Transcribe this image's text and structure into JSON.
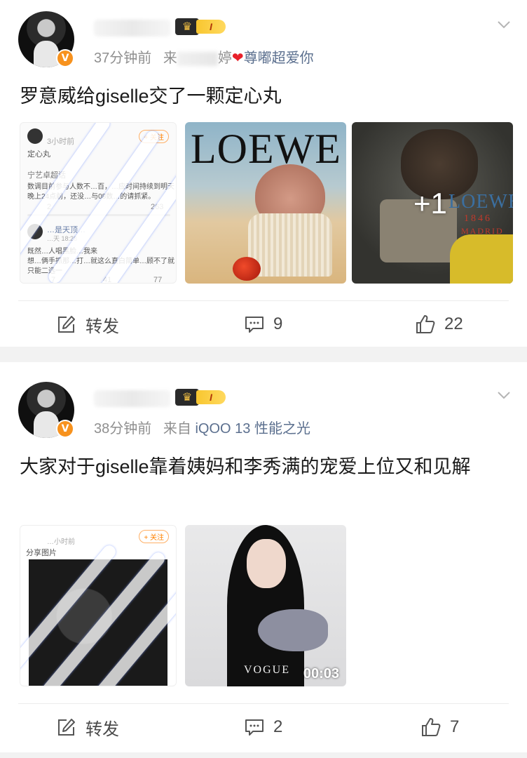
{
  "colors": {
    "accent": "#ff8200",
    "verified": "#f7921e",
    "meta_text": "#8f8f8f",
    "device_text": "#5b6f8e",
    "heart": "#e8202a"
  },
  "posts": [
    {
      "badge_level": "I",
      "time": "37分钟前",
      "source_prefix": "来",
      "source_suffix": "婷",
      "heart": "❤",
      "source_tail": "尊嘟超爱你",
      "text": "罗意威给giselle交了一颗定心丸",
      "images": [
        {
          "type": "screenshot",
          "follow": "+ 关注",
          "time_small": "3小时前",
          "title": "定心丸",
          "tag": "宁艺卓超话",
          "body": [
            "数调目前参与人数不…百，…应时间持续到明天",
            "晚上24点前，还没…与08数…的请抓紧。"
          ],
          "stats": [
            "2",
            "263"
          ],
          "reply_name": "…是天顶…",
          "reply_time": "…天 18:28",
          "reply_body": [
            "既然…人唱黑脸…我来",
            "想…俩手抓那…打…就这么直白简单…顾不了就",
            "只能二选一"
          ],
          "reply_stats": [
            "7",
            "41",
            "77"
          ]
        },
        {
          "type": "photo",
          "logo": "LOEWE"
        },
        {
          "type": "photo",
          "logo": "LOEWE",
          "sub1": "1846",
          "sub2": "MADRID",
          "more": "+1"
        }
      ],
      "actions": {
        "repost": "转发",
        "comments": "9",
        "likes": "22"
      }
    },
    {
      "badge_level": "I",
      "time": "38分钟前",
      "source_prefix": "来自",
      "device": "iQOO 13 性能之光",
      "text": "大家对于giselle靠着姨妈和李秀满的宠爱上位又和见解",
      "images": [
        {
          "type": "screenshot",
          "follow": "+ 关注",
          "time_small": "…小时前",
          "title": "分享图片"
        },
        {
          "type": "video",
          "brand": "VOGUE",
          "duration": "00:03"
        }
      ],
      "actions": {
        "repost": "转发",
        "comments": "2",
        "likes": "7"
      }
    }
  ],
  "icons": {
    "verified": "V",
    "crown": "♛",
    "chevron": "chevron-down-icon",
    "repost": "repost-icon",
    "comment": "comment-icon",
    "like": "thumbs-up-icon"
  }
}
